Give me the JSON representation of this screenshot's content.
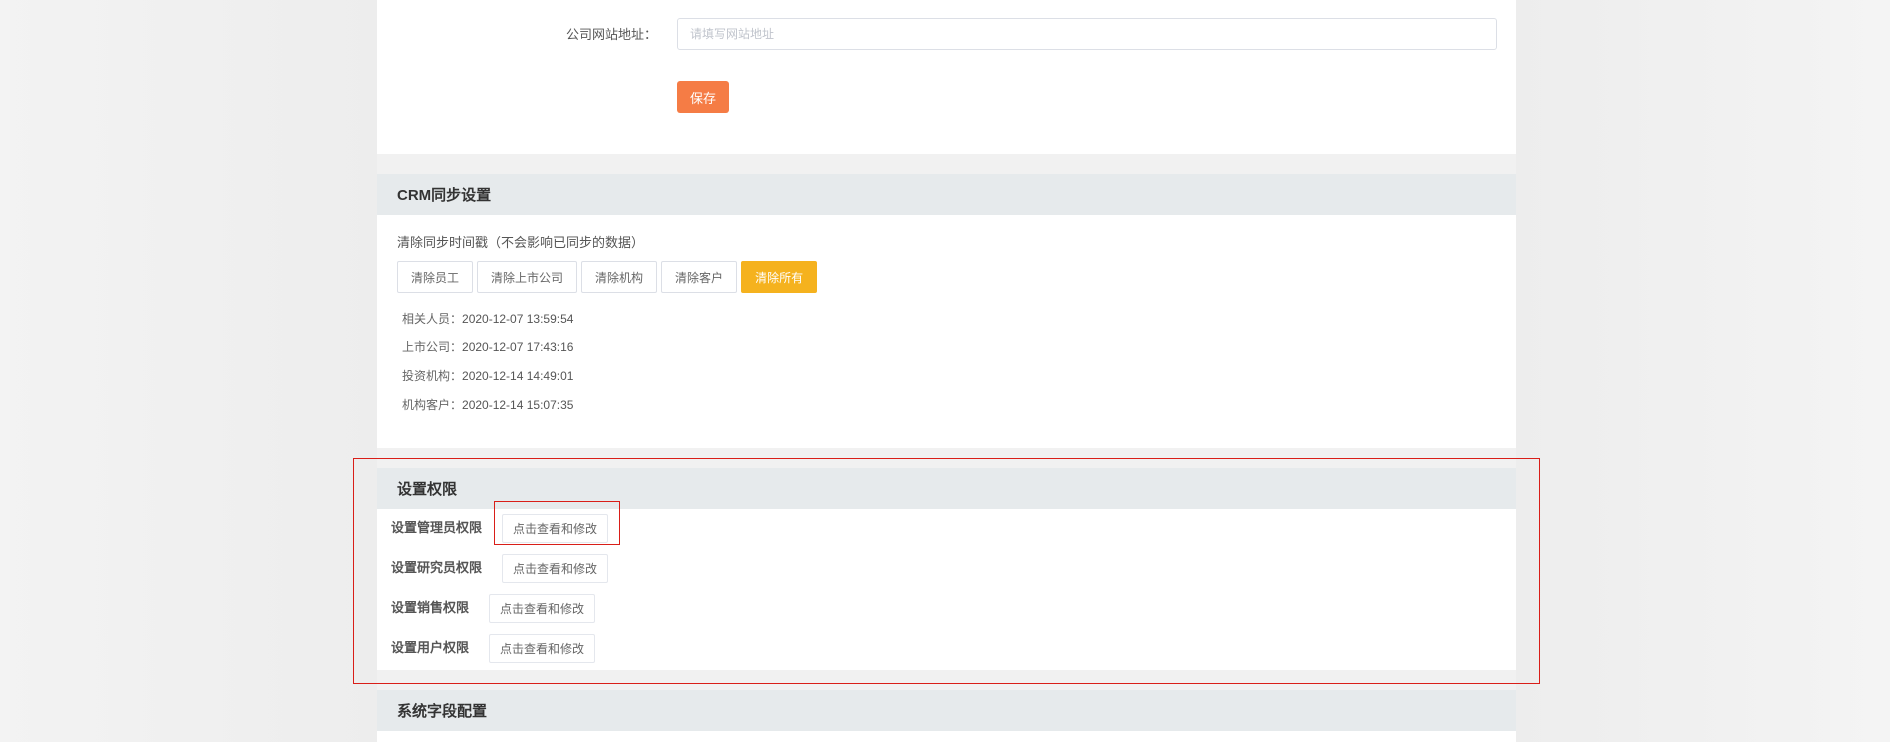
{
  "company": {
    "website_label": "公司网站地址：",
    "website_value": "",
    "website_placeholder": "请填写网站地址",
    "save_label": "保存"
  },
  "crm": {
    "title": "CRM同步设置",
    "subtitle": "清除同步时间戳（不会影响已同步的数据）",
    "buttons": [
      "清除员工",
      "清除上市公司",
      "清除机构",
      "清除客户",
      "清除所有"
    ],
    "timestamps": [
      {
        "label": "相关人员：",
        "value": "2020-12-07 13:59:54"
      },
      {
        "label": "上市公司：",
        "value": "2020-12-07 17:43:16"
      },
      {
        "label": "投资机构：",
        "value": "2020-12-14 14:49:01"
      },
      {
        "label": "机构客户：",
        "value": "2020-12-14 15:07:35"
      }
    ]
  },
  "permissions": {
    "title": "设置权限",
    "rows": [
      {
        "label": "设置管理员权限",
        "button": "点击查看和修改"
      },
      {
        "label": "设置研究员权限",
        "button": "点击查看和修改"
      },
      {
        "label": "设置销售权限",
        "button": "点击查看和修改"
      },
      {
        "label": "设置用户权限",
        "button": "点击查看和修改"
      }
    ]
  },
  "fields": {
    "title": "系统字段配置"
  },
  "colors": {
    "save_button": "#f57c45",
    "primary_button": "#f5b21e",
    "highlight": "#d91e18",
    "header_bg": "#e6eaec"
  }
}
